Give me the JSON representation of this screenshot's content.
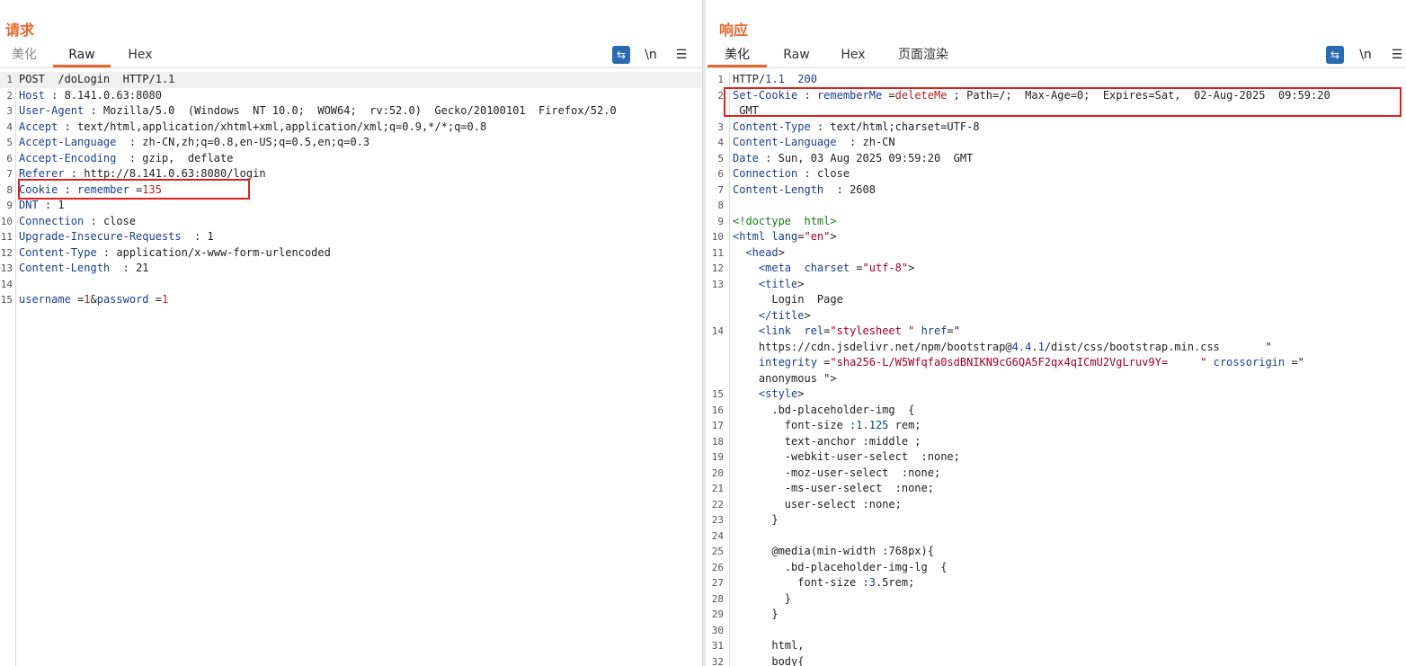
{
  "request": {
    "title": "请求",
    "tabs": [
      "美化",
      "Raw",
      "Hex"
    ],
    "active_tab": "Raw",
    "tools": {
      "wrap": "⇆",
      "newline": "\\n",
      "menu": "☰"
    }
  },
  "response": {
    "title": "响应",
    "tabs": [
      "美化",
      "Raw",
      "Hex",
      "页面渲染"
    ],
    "active_tab": "美化",
    "tools": {
      "wrap": "⇆",
      "newline": "\\n",
      "menu": "☰"
    }
  },
  "req_lines": [
    {
      "n": "1",
      "k": "",
      "v": "POST  /doLogin  HTTP/1.1"
    },
    {
      "n": "2",
      "k": "Host",
      "sep": " : ",
      "v": "8.141.0.63:8080"
    },
    {
      "n": "3",
      "k": "User-Agent",
      "sep": " : ",
      "v": "Mozilla/5.0  (Windows  NT 10.0;  WOW64;  rv:52.0)  Gecko/20100101  Firefox/52.0"
    },
    {
      "n": "4",
      "k": "Accept",
      "sep": " : ",
      "v": "text/html,application/xhtml+xml,application/xml;q=0.9,*/*;q=0.8"
    },
    {
      "n": "5",
      "k": "Accept-Language",
      "sep": "  : ",
      "v": "zh-CN,zh;q=0.8,en-US;q=0.5,en;q=0.3"
    },
    {
      "n": "6",
      "k": "Accept-Encoding",
      "sep": "  : ",
      "v": "gzip,  deflate"
    },
    {
      "n": "7",
      "k": "Referer",
      "sep": " : ",
      "v": "http://8.141.0.63:8080/login"
    },
    {
      "n": "8",
      "k": "Cookie",
      "sep": " : ",
      "k2": "remember",
      "eq": " =",
      "v2": "135"
    },
    {
      "n": "9",
      "k": "DNT",
      "sep": " : ",
      "v": "1"
    },
    {
      "n": "10",
      "k": "Connection",
      "sep": " : ",
      "v": "close"
    },
    {
      "n": "11",
      "k": "Upgrade-Insecure-Requests",
      "sep": "  : ",
      "v": "1"
    },
    {
      "n": "12",
      "k": "Content-Type",
      "sep": " : ",
      "v": "application/x-www-form-urlencoded"
    },
    {
      "n": "13",
      "k": "Content-Length",
      "sep": "  : ",
      "v": "21"
    },
    {
      "n": "14",
      "k": "",
      "v": ""
    },
    {
      "n": "15",
      "k": "username",
      "eq": " =",
      "v2": "1",
      "amp": "&",
      "k3": "password",
      "eq2": " =",
      "v3": "1"
    }
  ],
  "resp_lines": [
    "HTTP/1.1  200",
    "Set-Cookie : rememberMe =deleteMe ; Path=/;  Max-Age=0;  Expires=Sat,  02-Aug-2025  09:59:20",
    " GMT",
    "Content-Type : text/html;charset=UTF-8",
    "Content-Language  : zh-CN",
    "Date : Sun, 03 Aug 2025 09:59:20  GMT",
    "Connection : close",
    "Content-Length  : 2608",
    "",
    "<!doctype  html>",
    "<html lang=\"en\">",
    "  <head>",
    "    <meta  charset =\"utf-8\">",
    "    <title>",
    "      Login  Page",
    "    </title>",
    "    <link  rel=\"stylesheet \" href=\"",
    "    https://cdn.jsdelivr.net/npm/bootstrap@4.4.1/dist/css/bootstrap.min.css       \"",
    "    integrity =\"sha256-L/W5Wfqfa0sdBNIKN9cG6QA5F2qx4qICmU2VgLruv9Y=     \" crossorigin =\"",
    "    anonymous \">",
    "    <style>",
    "      .bd-placeholder-img  {",
    "        font-size :1.125 rem;",
    "        text-anchor :middle ;",
    "        -webkit-user-select  :none;",
    "        -moz-user-select  :none;",
    "        -ms-user-select  :none;",
    "        user-select :none;",
    "      }",
    "",
    "      @media(min-width :768px){",
    "        .bd-placeholder-img-lg  {",
    "          font-size :3.5rem;",
    "        }",
    "      }",
    "",
    "      html,",
    "      body{"
  ],
  "resp_numbers": [
    "1",
    "2",
    "",
    "3",
    "4",
    "5",
    "6",
    "7",
    "8",
    "9",
    "10",
    "11",
    "12",
    "13",
    "",
    "",
    "14",
    "",
    "",
    "",
    "15",
    "16",
    "17",
    "18",
    "19",
    "20",
    "21",
    "22",
    "23",
    "24",
    "25",
    "26",
    "27",
    "28",
    "29",
    "30",
    "31",
    "32"
  ],
  "colors": {
    "accent": "#e8662d",
    "highlight_box": "#e02020",
    "tool_blue": "#2a6ab3"
  },
  "layout_buttons": [
    "split-horizontal-icon",
    "split-vertical-icon",
    "single-pane-icon"
  ]
}
